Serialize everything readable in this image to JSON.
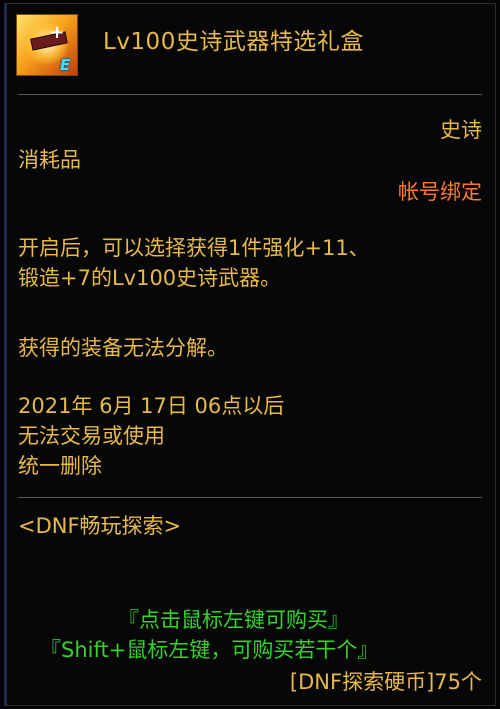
{
  "item": {
    "icon_name": "epic-weapon-gift-box-icon",
    "grade_letter": "E",
    "name": "Lv100史诗武器特选礼盒",
    "rarity": "史诗",
    "type": "消耗品",
    "binding": "帐号绑定",
    "description": [
      "开启后，可以选择获得1件强化+11、",
      "锻造+7的Lv100史诗武器。"
    ],
    "note": "获得的装备无法分解。",
    "expiry": [
      "2021年 6月 17日 06点以后",
      "无法交易或使用",
      "统一删除"
    ],
    "source": "<DNF畅玩探索>",
    "purchase": {
      "click_hint": "『点击鼠标左键可购买』",
      "shift_hint": "『Shift+鼠标左键，可购买若干个』",
      "price": "[DNF探索硬币]75个"
    }
  },
  "colors": {
    "title": "#e7b94b",
    "binding": "#ff7b30",
    "purchase_hint": "#35d12c",
    "background": "#070707"
  }
}
